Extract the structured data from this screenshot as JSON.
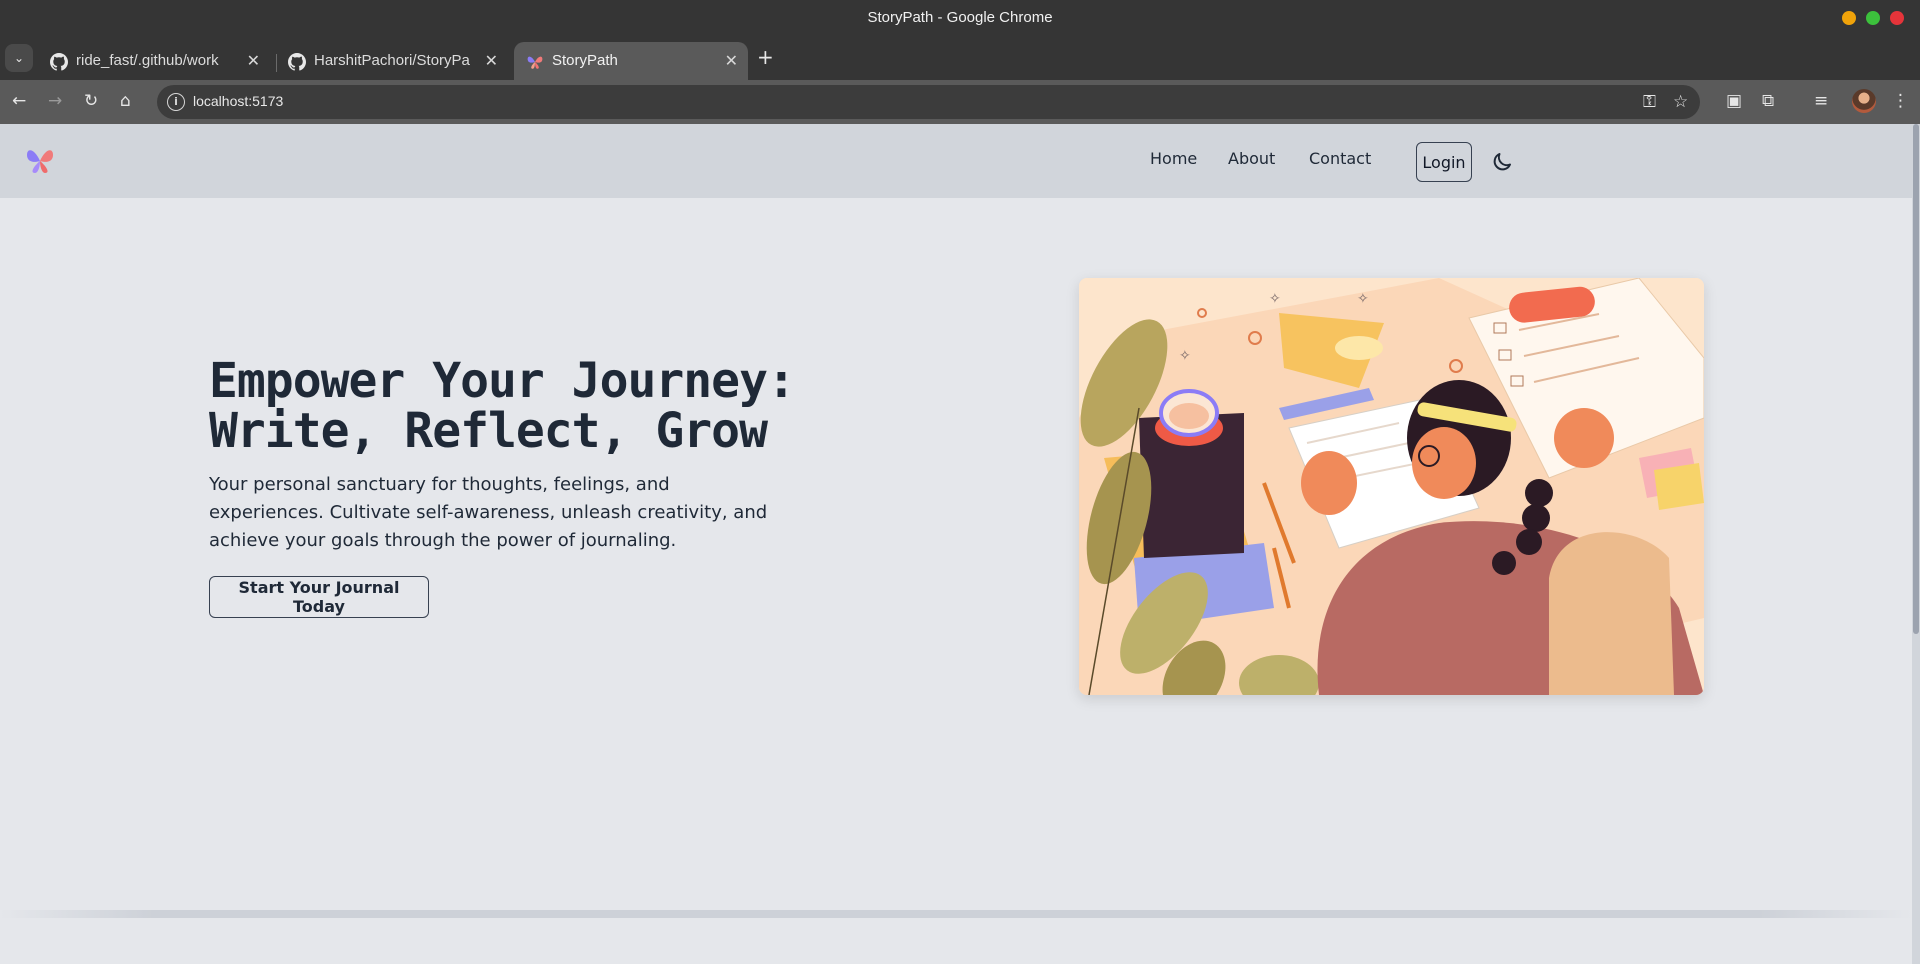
{
  "window": {
    "title": "StoryPath - Google Chrome",
    "controls": [
      "minimize",
      "maximize",
      "close"
    ]
  },
  "tabs": [
    {
      "label": "ride_fast/.github/work",
      "icon": "github-icon",
      "active": false
    },
    {
      "label": "HarshitPachori/StoryPa",
      "icon": "github-icon",
      "active": false
    },
    {
      "label": "StoryPath",
      "icon": "butterfly-logo-icon",
      "active": true
    }
  ],
  "toolbar": {
    "url": "localhost:5173"
  },
  "navbar": {
    "links": [
      "Home",
      "About",
      "Contact"
    ],
    "login_label": "Login"
  },
  "hero": {
    "title_line1": "Empower Your Journey:",
    "title_line2": "Write, Reflect, Grow",
    "subtitle": "Your personal sanctuary for thoughts, feelings, and experiences. Cultivate self-awareness, unleash creativity, and achieve your goals through the power of journaling.",
    "cta_label": "Start Your Journal Today"
  },
  "colors": {
    "navbar_bg": "#d1d5db",
    "page_bg": "#e5e7eb",
    "text": "#1f2937"
  }
}
